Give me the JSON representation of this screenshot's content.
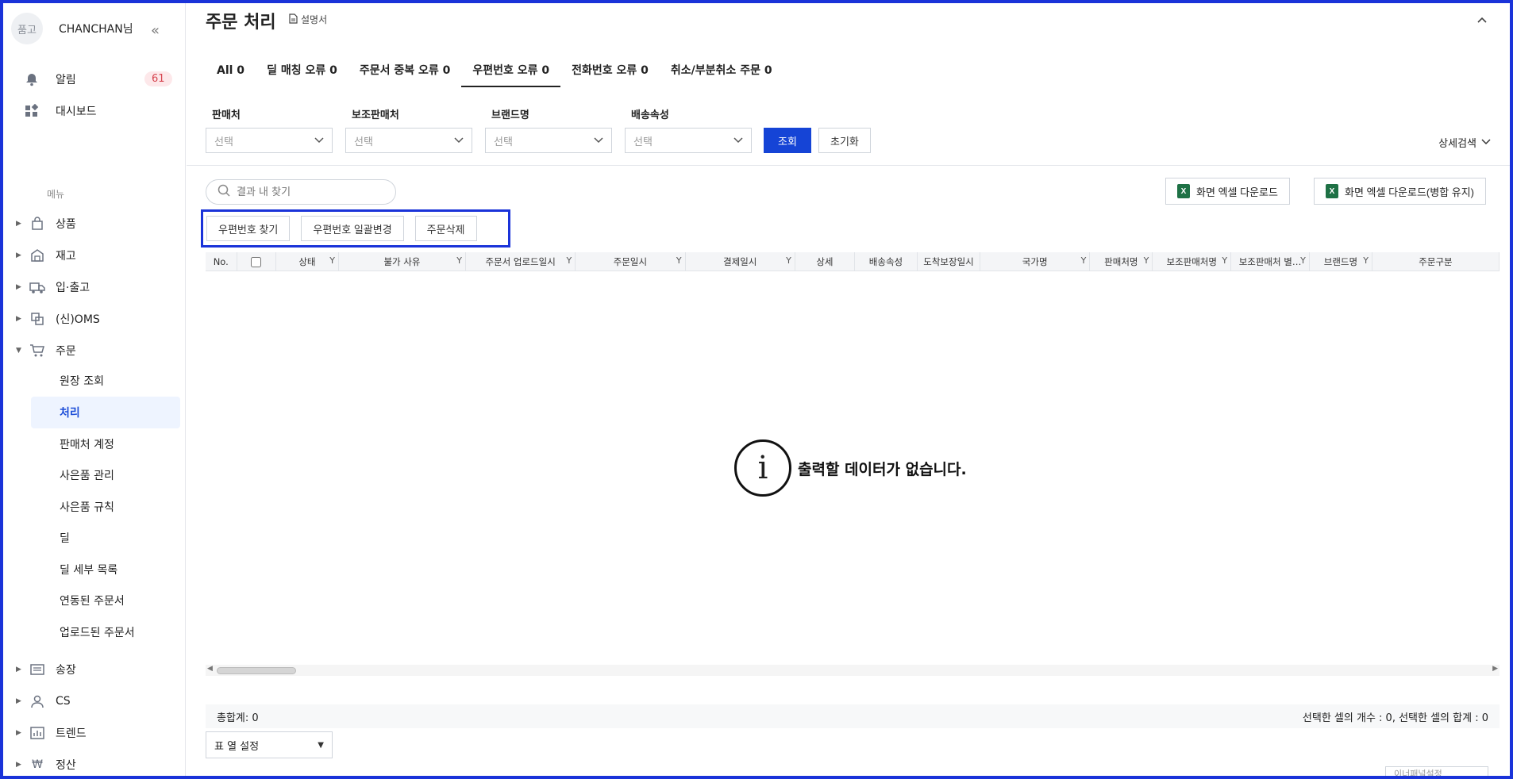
{
  "sidebar": {
    "avatar_text": "품고",
    "username": "CHANCHAN님",
    "collapse_icon": "«",
    "notifications_label": "알림",
    "notifications_count": "61",
    "dashboard_label": "대시보드",
    "menu_label": "메뉴",
    "nav": [
      {
        "label": "상품"
      },
      {
        "label": "재고"
      },
      {
        "label": "입·출고"
      },
      {
        "label": "(신)OMS"
      },
      {
        "label": "주문"
      }
    ],
    "order_sub": [
      {
        "label": "원장 조회"
      },
      {
        "label": "처리"
      },
      {
        "label": "판매처 계정"
      },
      {
        "label": "사은품 관리"
      },
      {
        "label": "사은품 규칙"
      },
      {
        "label": "딜"
      },
      {
        "label": "딜 세부 목록"
      },
      {
        "label": "연동된 주문서"
      },
      {
        "label": "업로드된 주문서"
      }
    ],
    "nav_bottom": [
      {
        "label": "송장"
      },
      {
        "label": "CS"
      },
      {
        "label": "트렌드"
      },
      {
        "label": "정산"
      }
    ]
  },
  "header": {
    "title": "주문 처리",
    "manual_label": "설명서"
  },
  "tabs": [
    {
      "label": "All 0"
    },
    {
      "label": "딜 매칭 오류 0"
    },
    {
      "label": "주문서 중복 오류 0"
    },
    {
      "label": "우편번호 오류 0"
    },
    {
      "label": "전화번호 오류 0"
    },
    {
      "label": "취소/부분취소 주문 0"
    }
  ],
  "filters": [
    {
      "label": "판매처",
      "value": "선택"
    },
    {
      "label": "보조판매처",
      "value": "선택"
    },
    {
      "label": "브랜드명",
      "value": "선택"
    },
    {
      "label": "배송속성",
      "value": "선택"
    }
  ],
  "buttons": {
    "search": "조회",
    "reset": "초기화",
    "detail_search": "상세검색",
    "excel_download": "화면 엑셀 다운로드",
    "excel_download_merged": "화면 엑셀 다운로드(병합 유지)",
    "find_zip": "우편번호 찾기",
    "bulk_zip_change": "우편번호 일괄변경",
    "delete_order": "주문삭제",
    "column_setting": "표 열 설정",
    "floating": "이너패널설정"
  },
  "search": {
    "placeholder": "결과 내 찾기"
  },
  "table": {
    "columns": [
      "No.",
      "",
      "상태",
      "불가 사유",
      "주문서 업로드일시",
      "주문일시",
      "결제일시",
      "상세",
      "배송속성",
      "도착보장일시",
      "국가명",
      "판매처명",
      "보조판매처명",
      "보조판매처 별…",
      "브랜드명",
      "주문구분"
    ],
    "empty_message": "출력할 데이터가 없습니다."
  },
  "footer": {
    "total": "총합계: 0",
    "selection": "선택한 셀의 개수 : 0, 선택한 셀의 합계 : 0"
  },
  "colors": {
    "primary": "#1544d6",
    "highlight_border": "#1a33d9",
    "badge_bg": "#fde8ea",
    "badge_text": "#d64550",
    "active_sub_bg": "#eef4ff"
  }
}
